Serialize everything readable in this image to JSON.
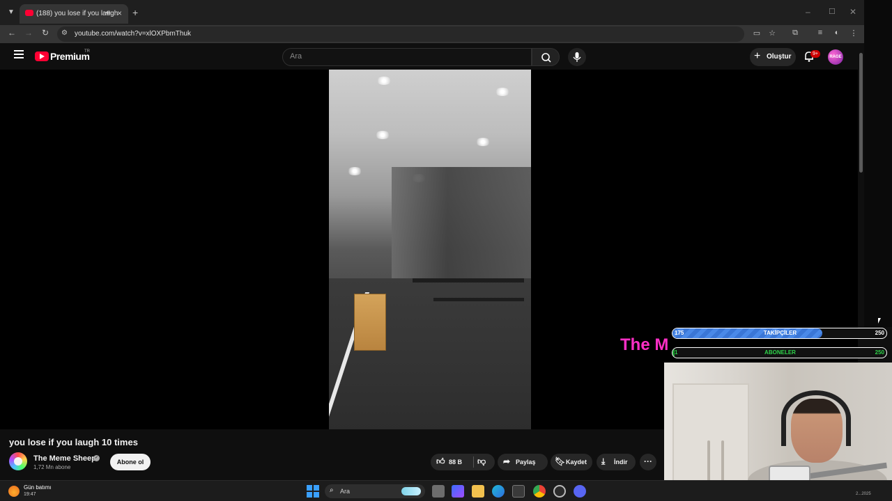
{
  "browser": {
    "tab": {
      "title": "(188) you lose if you laugh",
      "audio_icon": "speaker-icon",
      "close": "×"
    },
    "new_tab": "+",
    "window_controls": {
      "minimize": "–",
      "maximize": "☐",
      "close": "✕"
    },
    "address": {
      "url": "youtube.com/watch?v=xlOXPbmThuk"
    },
    "nav_icons": [
      "back-icon",
      "forward-icon",
      "reload-icon"
    ],
    "right_icons": [
      "cast-icon",
      "bookmark-star-icon",
      "extensions-icon",
      "media-icon",
      "profile-icon",
      "menu-icon"
    ]
  },
  "youtube": {
    "logo": {
      "text": "Premium",
      "region": "TR"
    },
    "search": {
      "placeholder": "Ara"
    },
    "create_label": "Oluştur",
    "notifications_badge": "9+",
    "avatar_text": "RAGE",
    "watermark": "The M",
    "video": {
      "title": "you lose if you laugh 10 times",
      "channel": "The Meme Sheep",
      "subscribers": "1,72 Mn abone",
      "subscribe_label": "Abone ol",
      "likes": "88 B",
      "share_label": "Paylaş",
      "save_label": "Kaydet",
      "download_label": "İndir",
      "more_label": "···"
    }
  },
  "overlay": {
    "followers_goal": {
      "current": "175",
      "title": "TAKİPÇİLER",
      "target": "250",
      "progress": 0.7
    },
    "subscribers_goal": {
      "current": "1",
      "title": "ABONELER",
      "target": "250",
      "progress": 0.01
    }
  },
  "taskbar": {
    "weather": {
      "label": "Gün batımı",
      "time": "19:47"
    },
    "search_label": "Ara",
    "clock_date": "2...2025"
  },
  "colors": {
    "yt_red": "#ff0033",
    "followers_fill": "#3a76d6",
    "subscribers_fill": "#1b9a2e",
    "watermark": "#ff2fc6"
  }
}
